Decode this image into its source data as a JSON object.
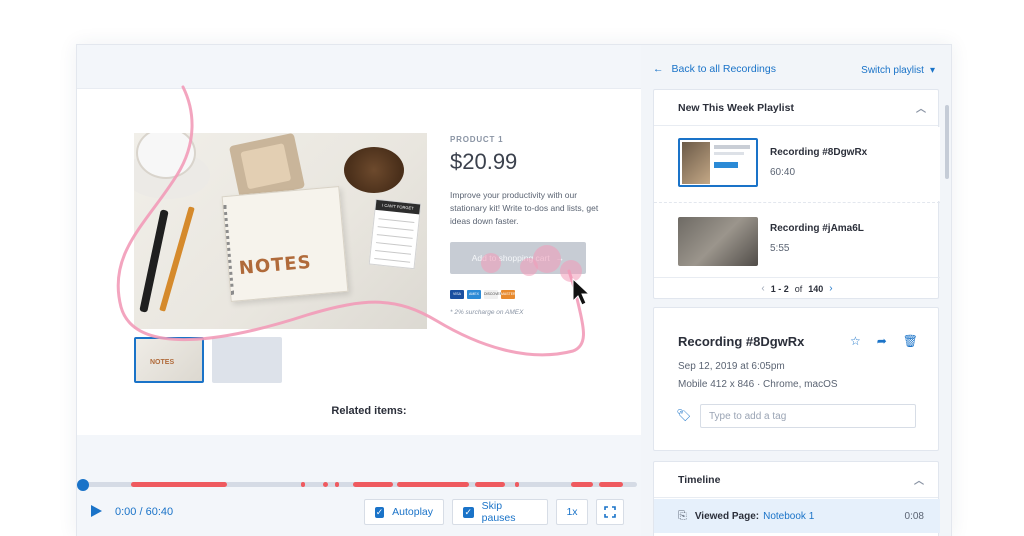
{
  "product": {
    "category": "PRODUCT 1",
    "price": "$20.99",
    "description": "Improve your productivity with our stationary kit! Write to-dos and lists, get ideas down faster.",
    "add_to_cart": "Add to shopping cart",
    "surcharge": "* 2% surcharge on AMEX",
    "image_text": "NOTES",
    "pad_header": "I CAN'T FORGET",
    "cards": [
      "VISA",
      "AMEX",
      "DISCOVER",
      "MASTERCARD"
    ]
  },
  "related_label": "Related items:",
  "player": {
    "time": "0:00 / 60:40",
    "autoplay": "Autoplay",
    "skip_pauses": "Skip pauses",
    "speed": "1x",
    "progress": 0
  },
  "sidebar": {
    "back": "Back to all Recordings",
    "switch": "Switch playlist",
    "playlist_title": "New This Week Playlist",
    "recordings": [
      {
        "title": "Recording #8DgwRx",
        "duration": "60:40"
      },
      {
        "title": "Recording #jAma6L",
        "duration": "5:55"
      }
    ],
    "pager_range": "1 - 2",
    "pager_of": "of",
    "pager_total": "140"
  },
  "details": {
    "title": "Recording #8DgwRx",
    "date": "Sep 12, 2019 at 6:05pm",
    "device": "Mobile 412 x 846  ·  Chrome, macOS",
    "tag_placeholder": "Type to add a tag"
  },
  "timeline": {
    "title": "Timeline",
    "event_label": "Viewed Page:",
    "event_link": "Notebook 1",
    "event_time": "0:08"
  },
  "colors": {
    "accent": "#1a73c8",
    "activity": "#ef5a5f",
    "mouse_trail": "#f29bb8"
  }
}
